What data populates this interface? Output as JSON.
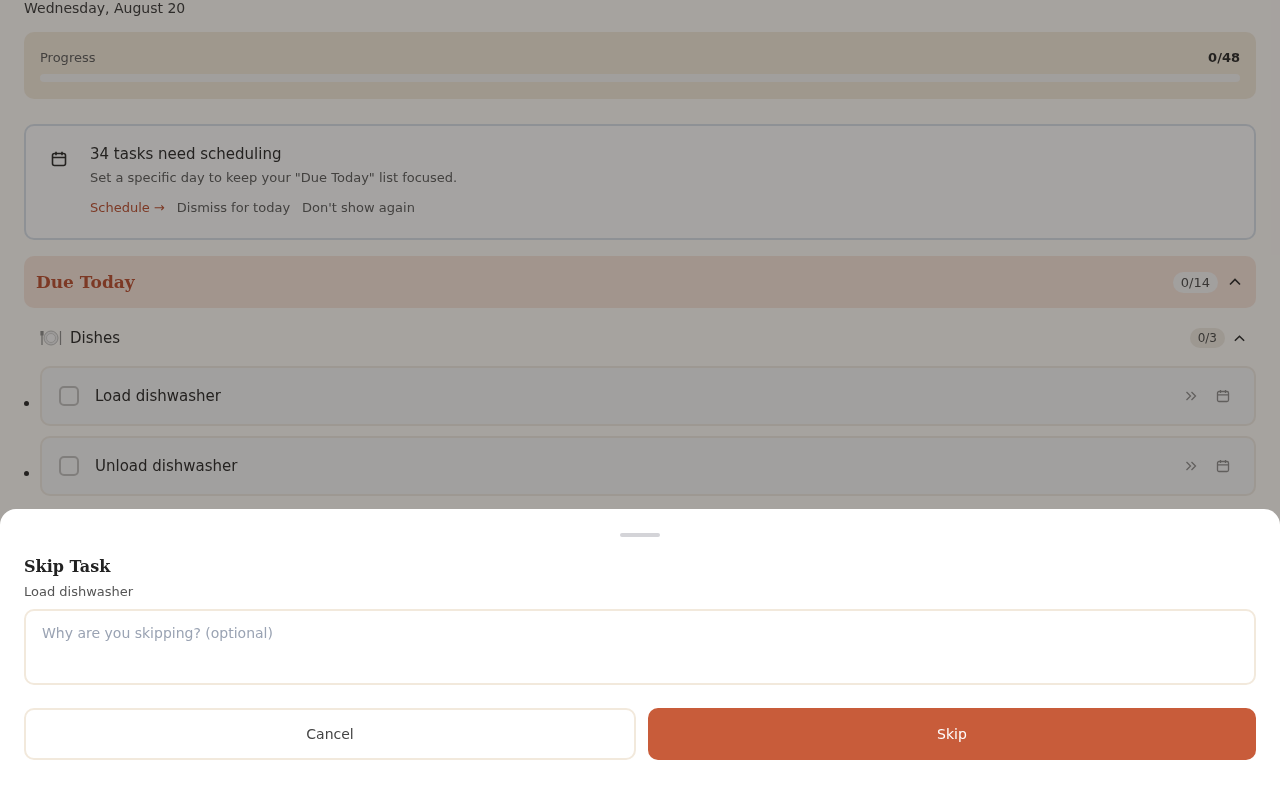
{
  "date": "Wednesday, August 20",
  "progress": {
    "label": "Progress",
    "count": "0/48",
    "level": 0
  },
  "notice": {
    "title": "34 tasks need scheduling",
    "body": "Set a specific day to keep your \"Due Today\" list focused.",
    "actions": [
      {
        "label": "Schedule →",
        "kind": "primary"
      },
      {
        "label": "Dismiss for today",
        "kind": "plain"
      },
      {
        "label": "Don't show again",
        "kind": "plain"
      }
    ]
  },
  "section": {
    "title": "Due Today",
    "count": "0/14",
    "expanded": true,
    "groups": [
      {
        "name": "Dishes",
        "count": "0/3",
        "expanded": true,
        "tasks": [
          {
            "name": "Load dishwasher",
            "checked": false
          },
          {
            "name": "Unload dishwasher",
            "checked": false
          }
        ]
      }
    ]
  },
  "sheet": {
    "title": "Skip Task",
    "subtitle": "Load dishwasher",
    "reason": {
      "placeholder": "Why are you skipping? (optional)"
    },
    "buttons": [
      {
        "label": "Cancel",
        "kind": "secondary"
      },
      {
        "label": "Skip",
        "kind": "primary"
      }
    ]
  }
}
